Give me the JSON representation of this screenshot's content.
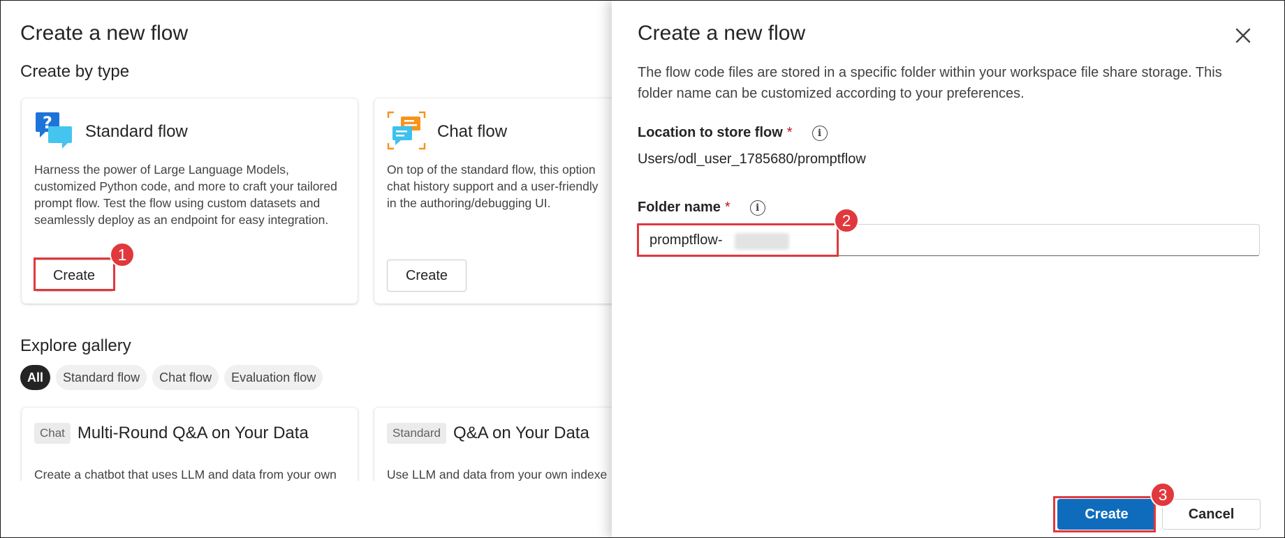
{
  "background": {
    "title": "Create a new flow",
    "create_by_type_heading": "Create by type",
    "cards": [
      {
        "title": "Standard flow",
        "description": "Harness the power of Large Language Models, customized Python code, and more to craft your tailored prompt flow. Test the flow using custom datasets and seamlessly deploy as an endpoint for easy integration.",
        "button": "Create",
        "icon": "chat-question-icon"
      },
      {
        "title": "Chat flow",
        "description": "On top of the standard flow, this option chat history support and a user-friendly in the authoring/debugging UI.",
        "button": "Create",
        "icon": "chat-flow-icon"
      }
    ],
    "explore_heading": "Explore gallery",
    "filters": [
      "All",
      "Standard flow",
      "Chat flow",
      "Evaluation flow"
    ],
    "gallery": [
      {
        "tag": "Chat",
        "title": "Multi-Round Q&A on Your Data",
        "description": "Create a chatbot that uses LLM and data from your own"
      },
      {
        "tag": "Standard",
        "title": "Q&A on Your Data",
        "description": "Use LLM and data from your own indexe"
      }
    ]
  },
  "panel": {
    "title": "Create a new flow",
    "description": "The flow code files are stored in a specific folder within your workspace file share storage. This folder name can be customized according to your preferences.",
    "location_label": "Location to store flow",
    "location_value": "Users/odl_user_1785680/promptflow",
    "folder_label": "Folder name",
    "required_mark": "*",
    "info_glyph": "i",
    "folder_value": "promptflow-",
    "create_button": "Create",
    "cancel_button": "Cancel"
  },
  "annotations": [
    "1",
    "2",
    "3"
  ],
  "colors": {
    "accent": "#0f6cbd",
    "annotation": "#e0383d"
  }
}
